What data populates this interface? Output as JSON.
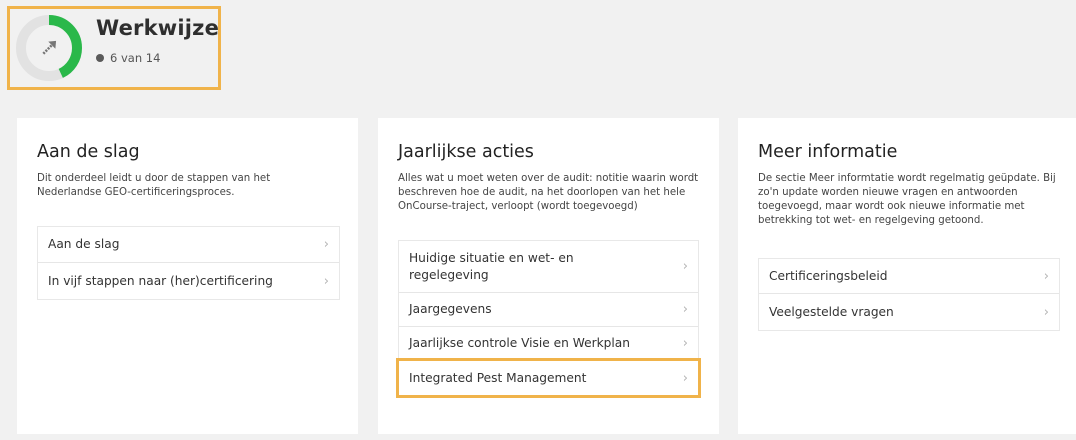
{
  "header": {
    "title": "Werkwijze",
    "progress_text": "6 van 14",
    "progress_fraction": 0.43,
    "colors": {
      "ring": "#2ab84a",
      "ring_track": "#e2e2e2",
      "highlight": "#f0b34a"
    }
  },
  "cards": [
    {
      "title": "Aan de slag",
      "description": "Dit onderdeel leidt u door de stappen van het Nederlandse GEO-certificeringsproces.",
      "items": [
        "Aan de slag",
        "In vijf stappen naar (her)certificering"
      ]
    },
    {
      "title": "Jaarlijkse acties",
      "description": "Alles wat u moet weten over de audit: notitie waarin wordt beschreven hoe de audit, na het doorlopen van het hele OnCourse-traject, verloopt (wordt toegevoegd)",
      "items": [
        "Huidige situatie en wet- en regelegeving",
        "Jaargegevens",
        "Jaarlijkse controle Visie en Werkplan",
        "Integrated Pest Management"
      ]
    },
    {
      "title": "Meer informatie",
      "description": "De sectie Meer informtatie wordt regelmatig geüpdate. Bij zo'n update worden nieuwe vragen en antwoorden toegevoegd, maar wordt ook nieuwe informatie met betrekking tot wet- en regelgeving getoond.",
      "items": [
        "Certificeringsbeleid",
        "Veelgestelde vragen"
      ]
    }
  ],
  "chevron": "›"
}
